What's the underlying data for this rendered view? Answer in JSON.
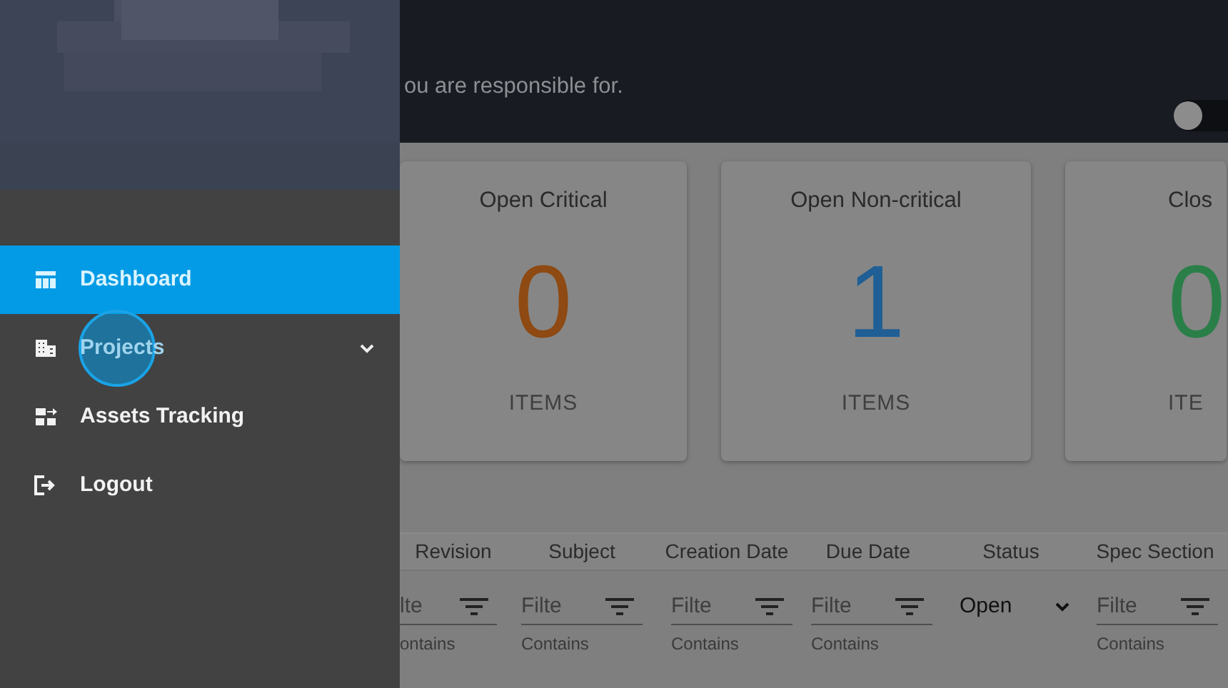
{
  "header": {
    "subtitle": "ou are responsible for.",
    "toggle": {
      "on": false
    }
  },
  "cards": [
    {
      "title": "Open Critical",
      "count": "0",
      "unit": "ITEMS",
      "color": "#8e4a12"
    },
    {
      "title": "Open Non-critical",
      "count": "1",
      "unit": "ITEMS",
      "color": "#1f5f95"
    },
    {
      "title": "Clos",
      "count": "0",
      "unit": "ITE",
      "color": "#2a7f48"
    }
  ],
  "table": {
    "columns": [
      {
        "label": "Revision",
        "kind": "text",
        "placeholder": "lte",
        "mode": "ontains"
      },
      {
        "label": "Subject",
        "kind": "text",
        "placeholder": "Filte",
        "mode": "Contains"
      },
      {
        "label": "Creation Date",
        "kind": "text",
        "placeholder": "Filte",
        "mode": "Contains"
      },
      {
        "label": "Due Date",
        "kind": "text",
        "placeholder": "Filte",
        "mode": "Contains"
      },
      {
        "label": "Status",
        "kind": "select",
        "value": "Open"
      },
      {
        "label": "Spec Section",
        "kind": "text",
        "placeholder": "Filte",
        "mode": "Contains"
      }
    ]
  },
  "sidebar": {
    "items": [
      {
        "label": "Dashboard",
        "selected": true,
        "expandable": false,
        "pressed": false
      },
      {
        "label": "Projects",
        "selected": false,
        "expandable": true,
        "pressed": true
      },
      {
        "label": "Assets Tracking",
        "selected": false,
        "expandable": false,
        "pressed": false
      },
      {
        "label": "Logout",
        "selected": false,
        "expandable": false,
        "pressed": false
      }
    ]
  }
}
